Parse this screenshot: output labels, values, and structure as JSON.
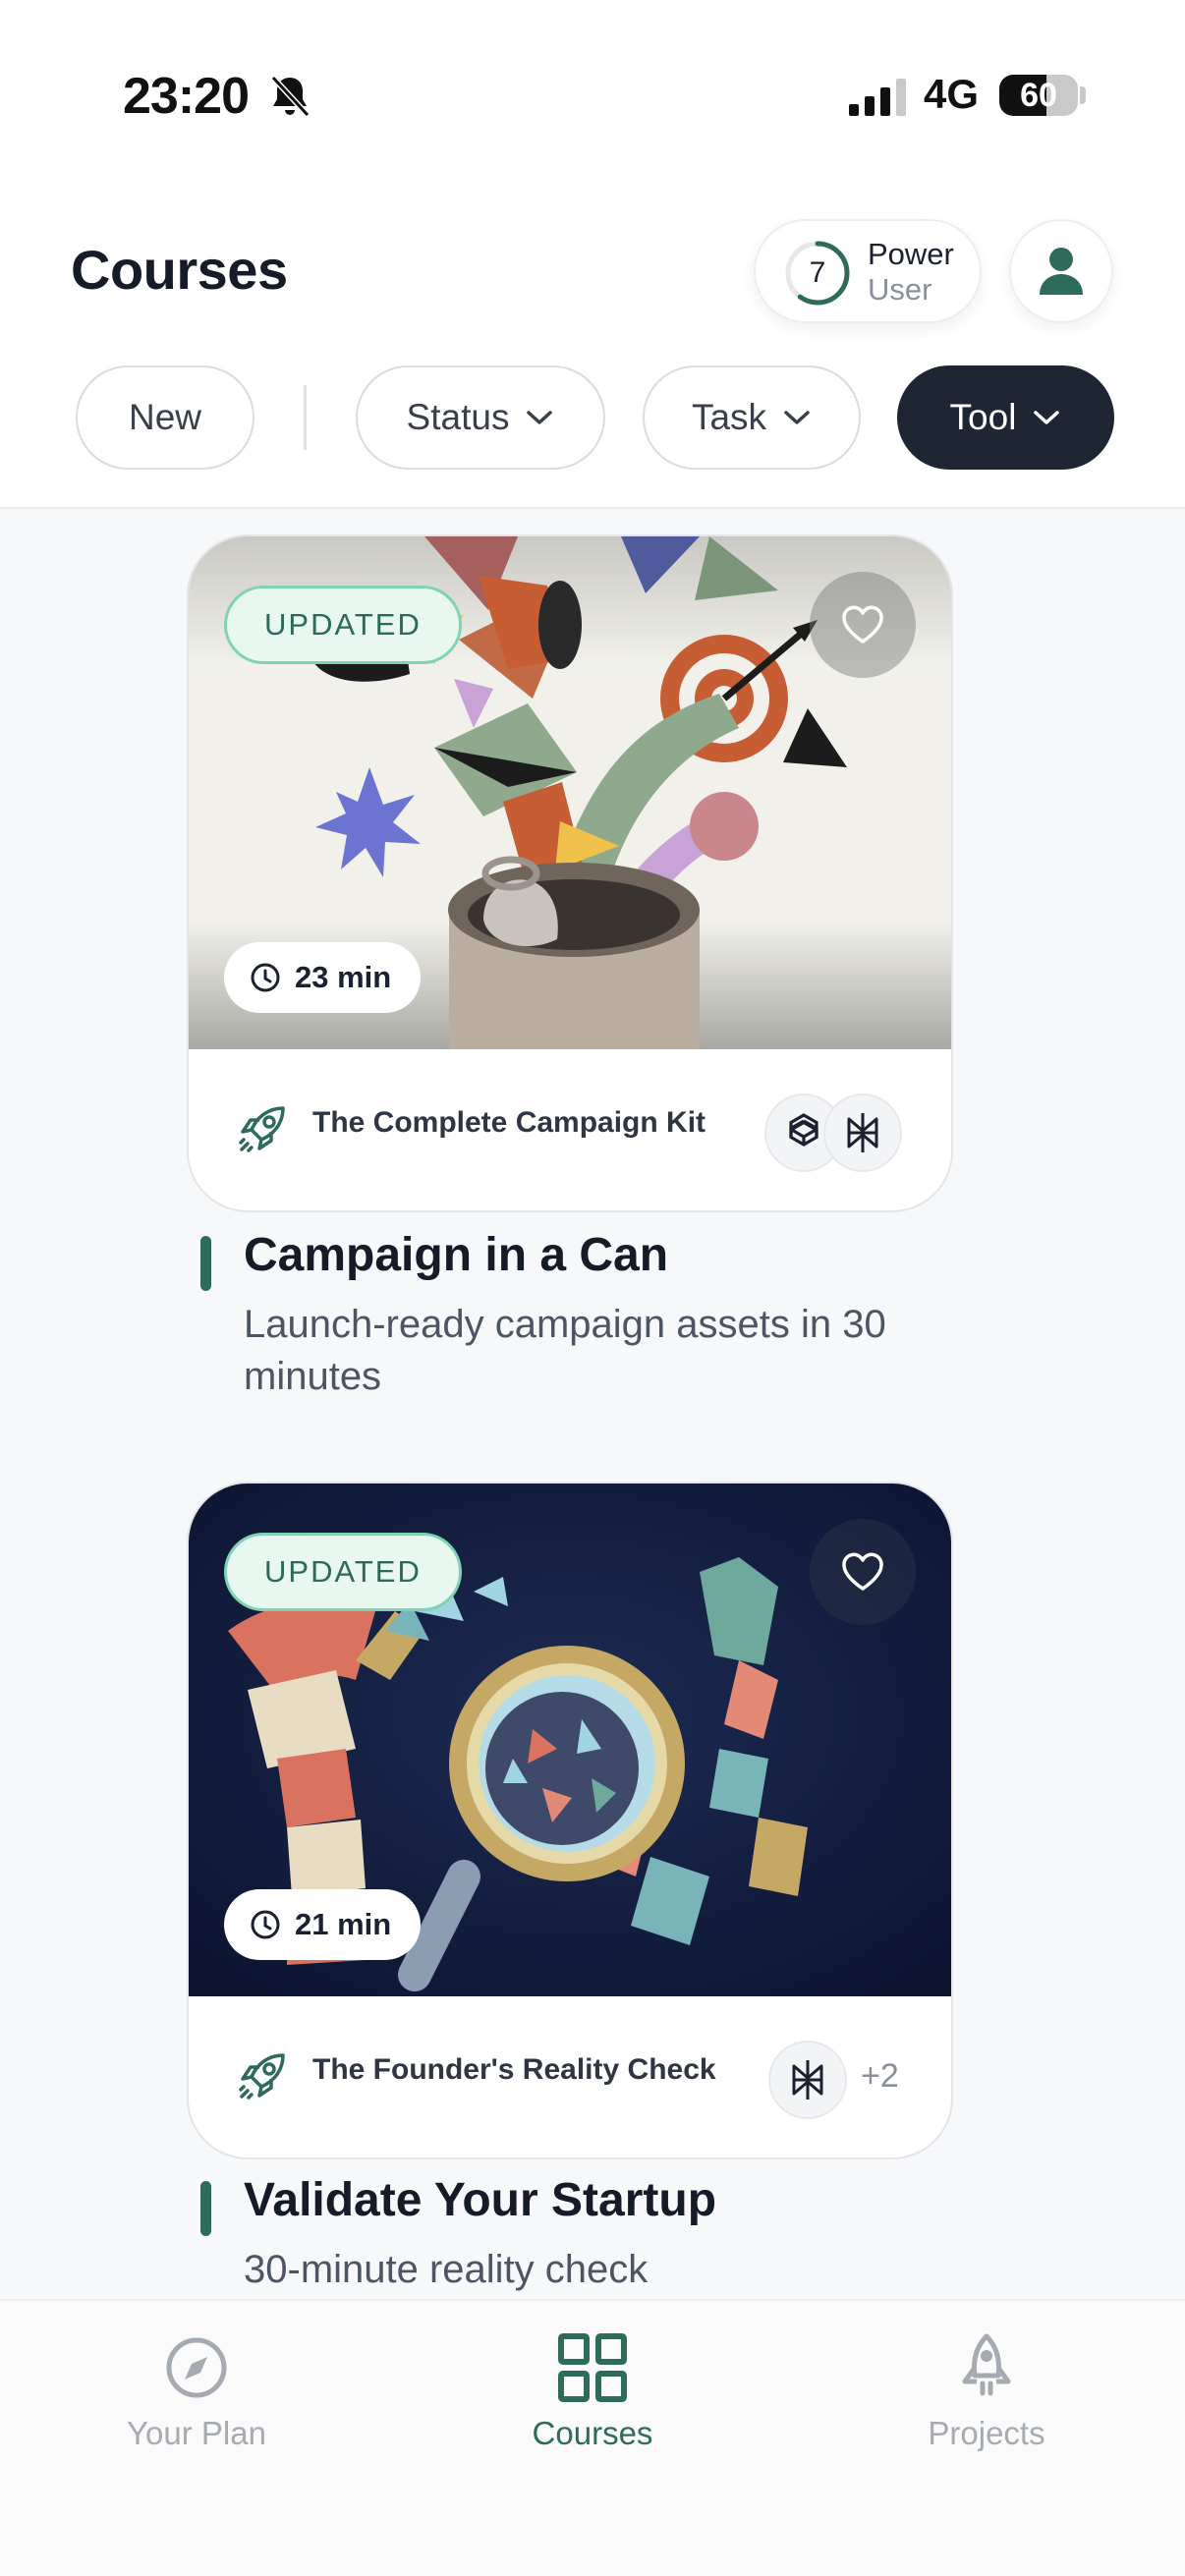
{
  "status_bar": {
    "time": "23:20",
    "network": "4G",
    "battery": "60",
    "battery_level": 0.6
  },
  "header": {
    "title": "Courses",
    "power_user": {
      "level": "7",
      "line1": "Power",
      "line2": "User",
      "progress": 0.6
    }
  },
  "filters": {
    "new_label": "New",
    "status_label": "Status",
    "task_label": "Task",
    "tool_label": "Tool"
  },
  "courses": [
    {
      "badge": "UPDATED",
      "duration": "23 min",
      "kit_name": "The Complete Campaign Kit",
      "tools": [
        "openai-icon",
        "perplexity-icon"
      ],
      "title": "Campaign in a Can",
      "subtitle": "Launch-ready campaign assets in 30 minutes"
    },
    {
      "badge": "UPDATED",
      "duration": "21 min",
      "kit_name": "The Founder's Reality Check",
      "tools": [
        "perplexity-icon"
      ],
      "more_tools": "+2",
      "title": "Validate Your Startup",
      "subtitle": "30-minute reality check"
    }
  ],
  "tabbar": {
    "your_plan": "Your Plan",
    "courses": "Courses",
    "projects": "Projects",
    "active": "Courses"
  },
  "colors": {
    "accent": "#2f6b5b",
    "badge_bg": "#e9f7f1",
    "badge_border": "#7ed3b2",
    "dark_chip": "#1e2533"
  }
}
